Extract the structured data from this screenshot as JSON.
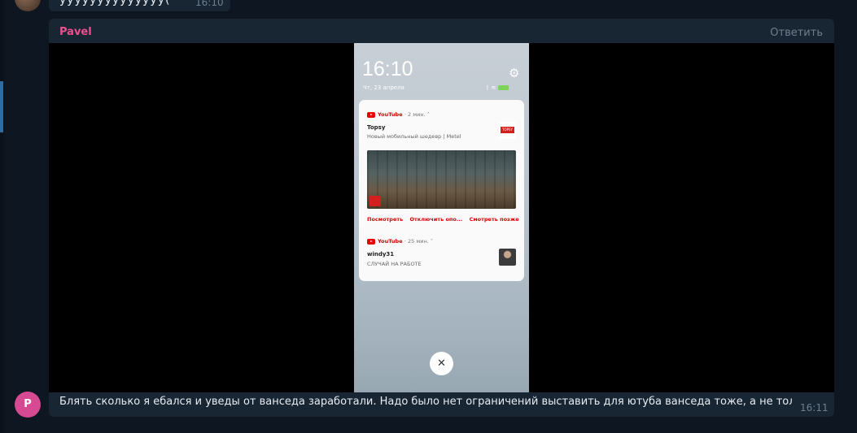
{
  "top_message": {
    "text": "уууууууууууууу(",
    "time": "16:10"
  },
  "message": {
    "sender": "Pavel",
    "reply_label": "Ответить",
    "avatar_letter": "P",
    "caption": "Блять сколько я ебался и уведы от ванседа заработали. Надо было нет ограничений выставить для ютуба ванседа тоже, а не только для микрог",
    "time": "16:11"
  },
  "screenshot": {
    "clock": "16:10",
    "date": "Чт, 23 апреля",
    "battery": "56",
    "close_symbol": "✕",
    "notification1": {
      "app": "YouTube",
      "age": "· 2 мин. ˄",
      "title": "Topsy",
      "subtitle": "Новый мобильный шедевр | Metel",
      "thumb_label": "TOPSY",
      "actions": [
        "Посмотреть",
        "Отключить опо...",
        "Смотреть позже"
      ]
    },
    "notification2": {
      "app": "YouTube",
      "age": "· 25 мин. ˅",
      "title": "windy31",
      "subtitle": "СЛУЧАЙ НА РАБОТЕ"
    }
  }
}
